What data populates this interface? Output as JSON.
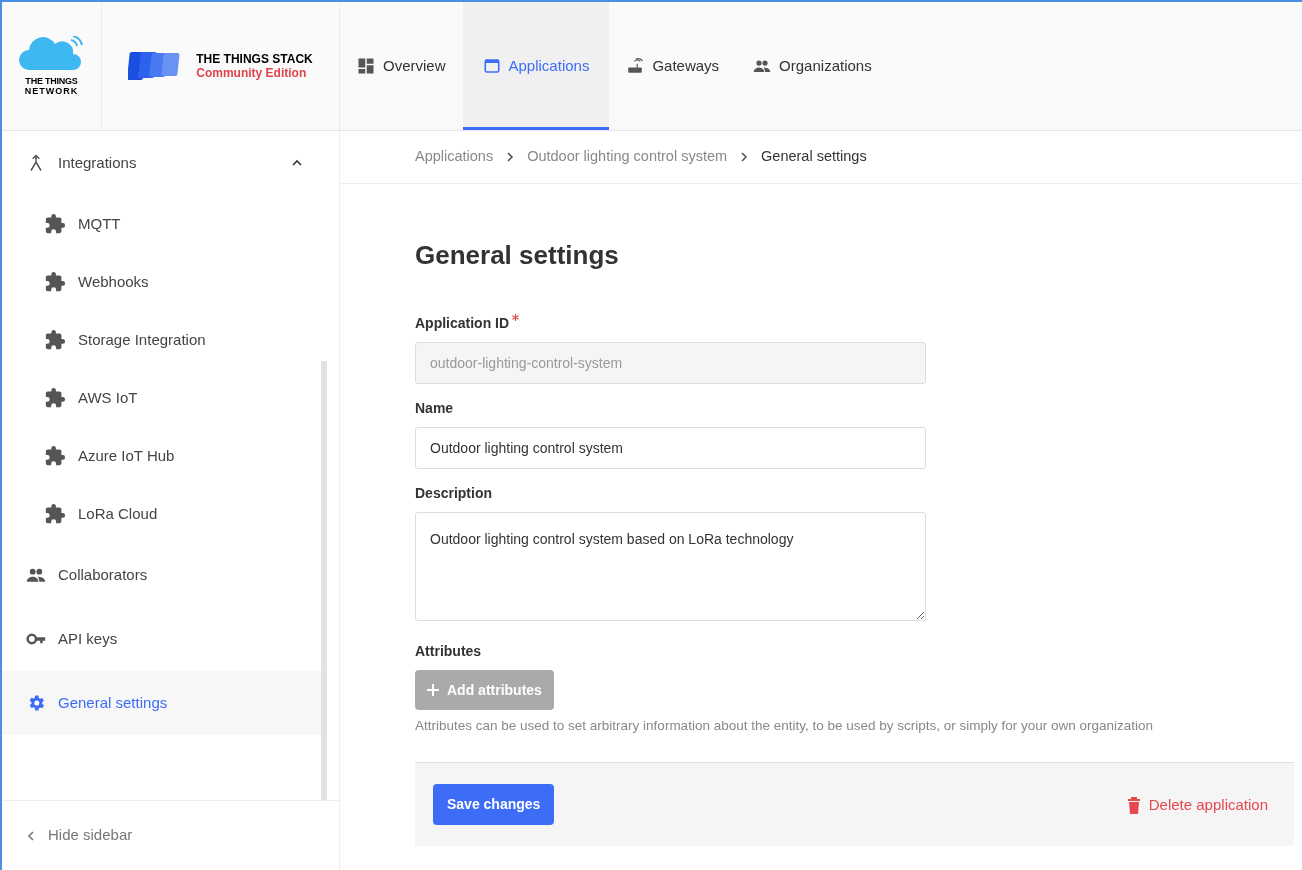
{
  "header": {
    "network_logo": {
      "line_1": "THE THINGS",
      "line_2": "NETWORK"
    },
    "stack_logo": {
      "title": "THE THINGS STACK",
      "subtitle": "Community Edition"
    },
    "nav": [
      {
        "label": "Overview",
        "selected": false
      },
      {
        "label": "Applications",
        "selected": true
      },
      {
        "label": "Gateways",
        "selected": false
      },
      {
        "label": "Organizations",
        "selected": false
      }
    ]
  },
  "sidebar": {
    "items": [
      {
        "label": "Integrations",
        "selected": false,
        "expanded": true,
        "children": [
          {
            "label": "MQTT",
            "selected": false
          },
          {
            "label": "Webhooks",
            "selected": false
          },
          {
            "label": "Storage Integration",
            "selected": false
          },
          {
            "label": "AWS IoT",
            "selected": false
          },
          {
            "label": "Azure IoT Hub",
            "selected": false
          },
          {
            "label": "LoRa Cloud",
            "selected": false
          }
        ]
      },
      {
        "label": "Collaborators",
        "selected": false
      },
      {
        "label": "API keys",
        "selected": false
      },
      {
        "label": "General settings",
        "selected": true
      }
    ],
    "hide_label": "Hide sidebar"
  },
  "breadcrumbs": [
    "Applications",
    "Outdoor lighting control system",
    "General settings"
  ],
  "title": "General settings",
  "form": {
    "fields": [
      {
        "kind": "input",
        "label": "Application ID",
        "required": true,
        "disabled": true,
        "value": "outdoor-lighting-control-system"
      },
      {
        "kind": "input",
        "label": "Name",
        "required": false,
        "disabled": false,
        "value": "Outdoor lighting control system"
      },
      {
        "kind": "textarea",
        "label": "Description",
        "required": false,
        "disabled": false,
        "value": "Outdoor lighting control system based on LoRa technology"
      }
    ],
    "attributes": {
      "label": "Attributes",
      "button": "Add attributes",
      "hint": "Attributes can be used to set arbitrary information about the entity, to be used by scripts, or simply for your own organization"
    },
    "save_button": "Save changes",
    "delete_button": "Delete application"
  }
}
